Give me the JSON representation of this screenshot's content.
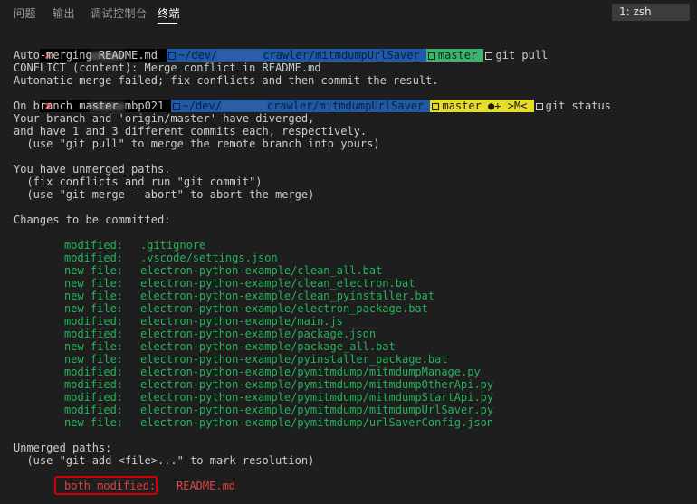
{
  "panel_tabs": [
    {
      "label": "问题"
    },
    {
      "label": "输出"
    },
    {
      "label": "调试控制台"
    },
    {
      "label": "终端"
    }
  ],
  "terminal_selector": "1: zsh",
  "prompt1": {
    "status": "✘",
    "user": "",
    "path": "~/dev/",
    "path_rest": "crawler/mitmdumpUrlSaver",
    "branch": "master",
    "command": "git pull"
  },
  "pull_output": [
    "Auto-merging README.md",
    "CONFLICT (content): Merge conflict in README.md",
    "Automatic merge failed; fix conflicts and then commit the result."
  ],
  "prompt2": {
    "status": "✘",
    "user": "mbp021",
    "path": "~/dev/",
    "path_rest": "crawler/mitmdumpUrlSaver",
    "branch": "master ●+ >M<",
    "command": "git status"
  },
  "status_header": [
    "On branch master",
    "Your branch and 'origin/master' have diverged,",
    "and have 1 and 3 different commits each, respectively.",
    "  (use \"git pull\" to merge the remote branch into yours)"
  ],
  "unmerged_hint": [
    "You have unmerged paths.",
    "  (fix conflicts and run \"git commit\")",
    "  (use \"git merge --abort\" to abort the merge)"
  ],
  "changes_title": "Changes to be committed:",
  "changes": [
    {
      "kind": "modified:",
      "file": ".gitignore"
    },
    {
      "kind": "modified:",
      "file": ".vscode/settings.json"
    },
    {
      "kind": "new file:",
      "file": "electron-python-example/clean_all.bat"
    },
    {
      "kind": "new file:",
      "file": "electron-python-example/clean_electron.bat"
    },
    {
      "kind": "new file:",
      "file": "electron-python-example/clean_pyinstaller.bat"
    },
    {
      "kind": "new file:",
      "file": "electron-python-example/electron_package.bat"
    },
    {
      "kind": "modified:",
      "file": "electron-python-example/main.js"
    },
    {
      "kind": "modified:",
      "file": "electron-python-example/package.json"
    },
    {
      "kind": "new file:",
      "file": "electron-python-example/package_all.bat"
    },
    {
      "kind": "new file:",
      "file": "electron-python-example/pyinstaller_package.bat"
    },
    {
      "kind": "modified:",
      "file": "electron-python-example/pymitmdump/mitmdumpManage.py"
    },
    {
      "kind": "modified:",
      "file": "electron-python-example/pymitmdump/mitmdumpOtherApi.py"
    },
    {
      "kind": "modified:",
      "file": "electron-python-example/pymitmdump/mitmdumpStartApi.py"
    },
    {
      "kind": "modified:",
      "file": "electron-python-example/pymitmdump/mitmdumpUrlSaver.py"
    },
    {
      "kind": "new file:",
      "file": "electron-python-example/pymitmdump/urlSaverConfig.json"
    }
  ],
  "unmerged_title": "Unmerged paths:",
  "unmerged_hint2": "  (use \"git add <file>...\" to mark resolution)",
  "conflict": {
    "kind": "both modified:",
    "file": "README.md"
  },
  "colors": {
    "green": "#23b45a",
    "red": "#e04343",
    "path_bg": "#1f5aa8",
    "clean_branch_bg": "#3cb371",
    "dirty_branch_bg": "#e4dc2c"
  }
}
